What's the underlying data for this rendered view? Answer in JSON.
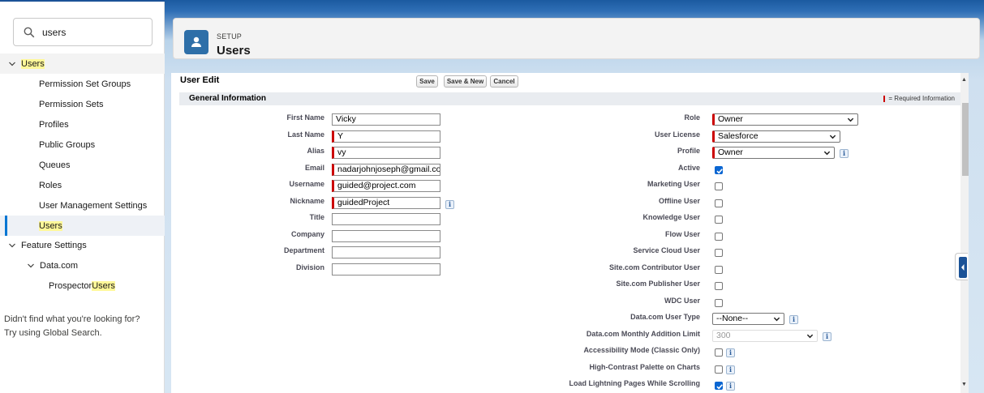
{
  "search": {
    "value": "users"
  },
  "sidebar": {
    "items": [
      {
        "label": "Users",
        "level": 0,
        "expanded": true,
        "highlight": true
      },
      {
        "label": "Permission Set Groups",
        "level": 2
      },
      {
        "label": "Permission Sets",
        "level": 2
      },
      {
        "label": "Profiles",
        "level": 2
      },
      {
        "label": "Public Groups",
        "level": 2
      },
      {
        "label": "Queues",
        "level": 2
      },
      {
        "label": "Roles",
        "level": 2
      },
      {
        "label": "User Management Settings",
        "level": 2
      },
      {
        "label": "Users",
        "level": 2,
        "selected": true,
        "highlight": true
      },
      {
        "label": "Feature Settings",
        "level": 0,
        "expanded": true
      },
      {
        "label": "Data.com",
        "level": 1,
        "expanded": true
      },
      {
        "label_prefix": "Prospector ",
        "label_highlight": "Users",
        "level": 3
      }
    ],
    "no_results_line1": "Didn't find what you're looking for?",
    "no_results_line2": "Try using Global Search."
  },
  "header": {
    "kicker": "SETUP",
    "title": "Users"
  },
  "form": {
    "title": "User Edit",
    "buttons": {
      "save": "Save",
      "save_new": "Save & New",
      "cancel": "Cancel"
    },
    "section": "General Information",
    "required_legend": "= Required Information",
    "left_fields": [
      {
        "label": "First Name",
        "value": "Vicky",
        "required": false
      },
      {
        "label": "Last Name",
        "value": "Y",
        "required": true
      },
      {
        "label": "Alias",
        "value": "vy",
        "required": true
      },
      {
        "label": "Email",
        "value": "nadarjohnjoseph@gmail.co",
        "required": true
      },
      {
        "label": "Username",
        "value": "guided@project.com",
        "required": true
      },
      {
        "label": "Nickname",
        "value": "guidedProject",
        "required": true,
        "info": true
      },
      {
        "label": "Title",
        "value": ""
      },
      {
        "label": "Company",
        "value": ""
      },
      {
        "label": "Department",
        "value": ""
      },
      {
        "label": "Division",
        "value": ""
      }
    ],
    "right_fields": [
      {
        "label": "Role",
        "kind": "select",
        "value": "Owner",
        "required": true
      },
      {
        "label": "User License",
        "kind": "select",
        "value": "Salesforce",
        "required": true
      },
      {
        "label": "Profile",
        "kind": "select",
        "value": "Owner",
        "required": true,
        "info": true
      },
      {
        "label": "Active",
        "kind": "checkbox",
        "checked": true
      },
      {
        "label": "Marketing User",
        "kind": "checkbox",
        "checked": false
      },
      {
        "label": "Offline User",
        "kind": "checkbox",
        "checked": false
      },
      {
        "label": "Knowledge User",
        "kind": "checkbox",
        "checked": false
      },
      {
        "label": "Flow User",
        "kind": "checkbox",
        "checked": false
      },
      {
        "label": "Service Cloud User",
        "kind": "checkbox",
        "checked": false
      },
      {
        "label": "Site.com Contributor User",
        "kind": "checkbox",
        "checked": false
      },
      {
        "label": "Site.com Publisher User",
        "kind": "checkbox",
        "checked": false
      },
      {
        "label": "WDC User",
        "kind": "checkbox",
        "checked": false
      },
      {
        "label": "Data.com User Type",
        "kind": "select",
        "value": "--None--",
        "info": true
      },
      {
        "label": "Data.com Monthly Addition Limit",
        "kind": "select",
        "value": "300",
        "disabled": true,
        "info": true
      },
      {
        "label": "Accessibility Mode (Classic Only)",
        "kind": "checkbox",
        "checked": false,
        "info": true
      },
      {
        "label": "High-Contrast Palette on Charts",
        "kind": "checkbox",
        "checked": false,
        "info": true
      },
      {
        "label": "Load Lightning Pages While Scrolling",
        "kind": "checkbox",
        "checked": true,
        "info": true
      }
    ]
  },
  "colors": {
    "brand": "#1b5297",
    "required": "#cc0000",
    "highlight": "#fff899",
    "checkbox": "#0a66d2"
  }
}
